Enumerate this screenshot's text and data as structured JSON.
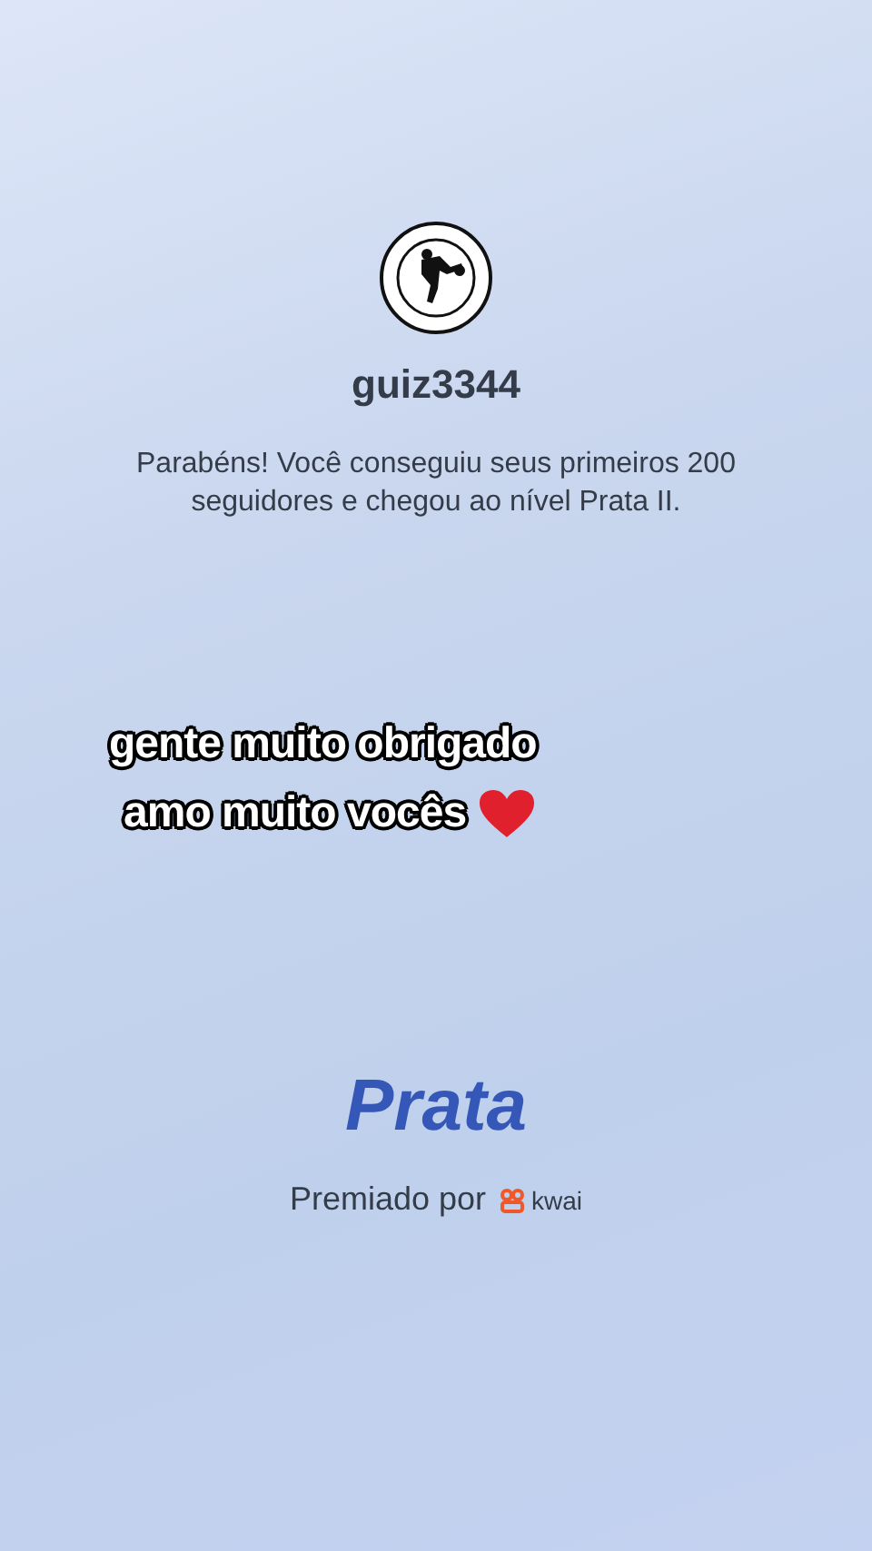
{
  "profile": {
    "username": "guiz3344",
    "message": "Parabéns! Você conseguiu seus primeiros 200 seguidores e chegou ao nível Prata II."
  },
  "caption": {
    "lines": [
      "gente muito obrigado",
      "amo muito vocês"
    ]
  },
  "badge": {
    "level_name": "Prata"
  },
  "footer": {
    "awarded_by": "Premiado por",
    "brand": "kwai"
  }
}
